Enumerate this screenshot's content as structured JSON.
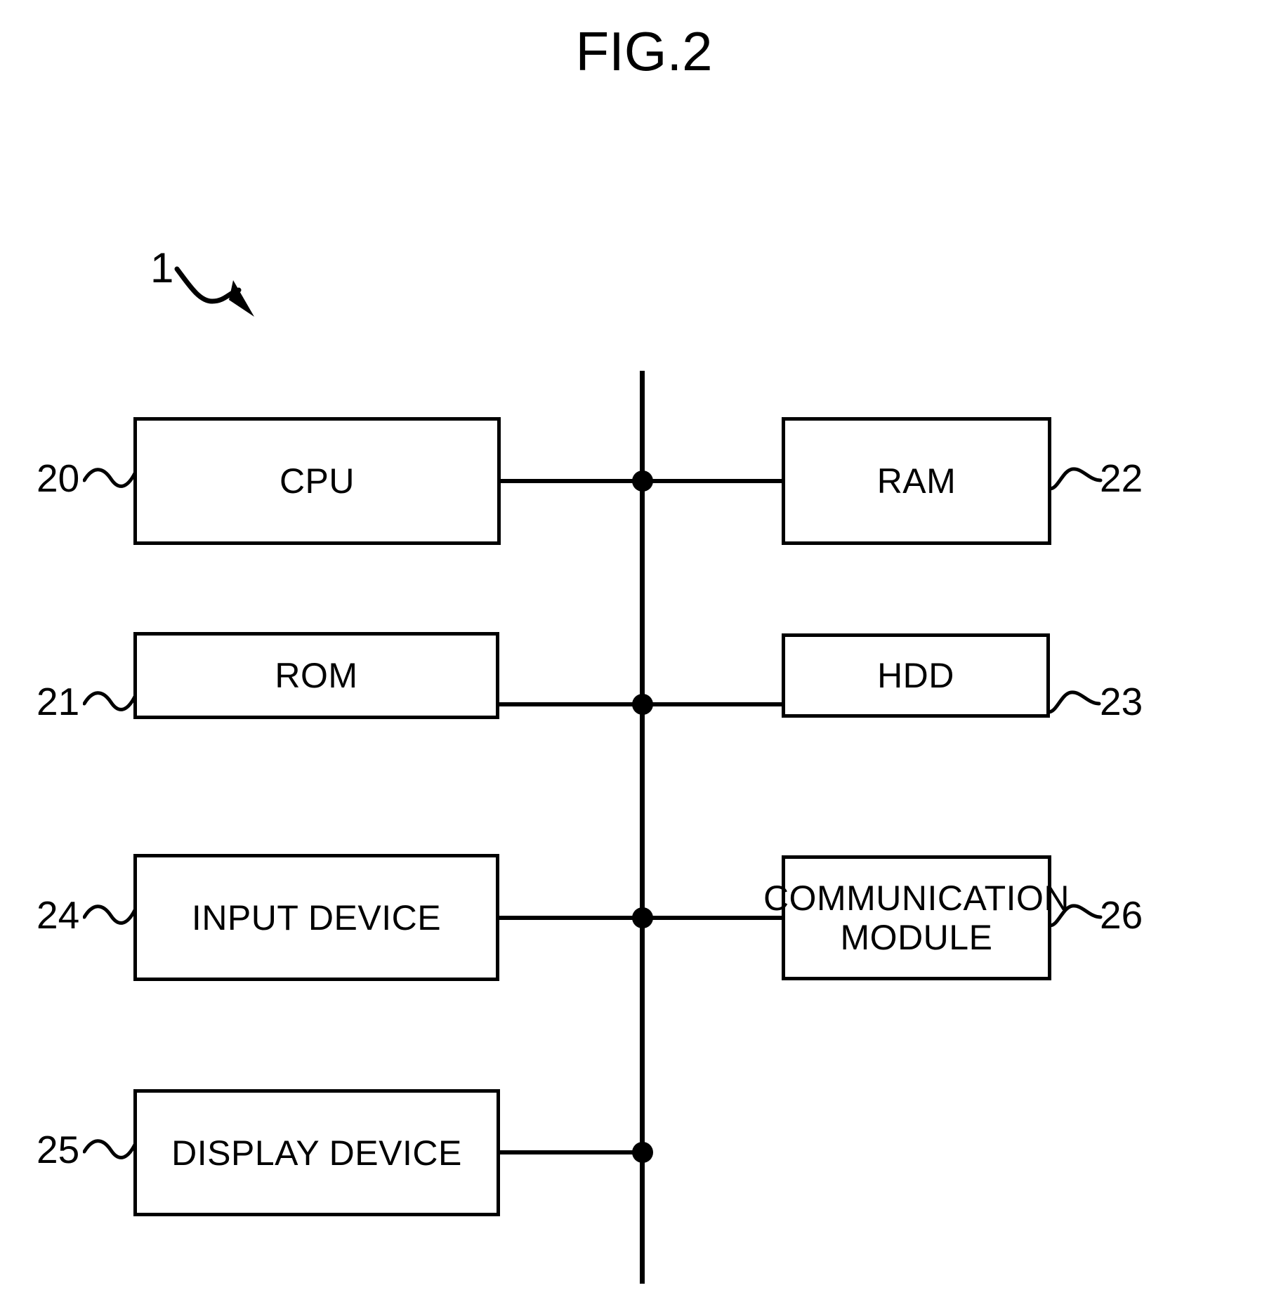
{
  "figure": {
    "title": "FIG.2",
    "system_ref": "1",
    "arrow_icon": "curved-arrow-icon"
  },
  "blocks": [
    {
      "id": "cpu",
      "label": "CPU",
      "ref": "20",
      "side": "left",
      "ref_side": "left"
    },
    {
      "id": "rom",
      "label": "ROM",
      "ref": "21",
      "side": "left",
      "ref_side": "left"
    },
    {
      "id": "input-device",
      "label": "INPUT DEVICE",
      "ref": "24",
      "side": "left",
      "ref_side": "left"
    },
    {
      "id": "display-device",
      "label": "DISPLAY DEVICE",
      "ref": "25",
      "side": "left",
      "ref_side": "left"
    },
    {
      "id": "ram",
      "label": "RAM",
      "ref": "22",
      "side": "right",
      "ref_side": "right"
    },
    {
      "id": "hdd",
      "label": "HDD",
      "ref": "23",
      "side": "right",
      "ref_side": "right"
    },
    {
      "id": "comm-module",
      "label": "COMMUNICATION\nMODULE",
      "ref": "26",
      "side": "right",
      "ref_side": "right"
    }
  ],
  "bus": {
    "name": "system-bus",
    "junction_count": 4
  },
  "colors": {
    "ink": "#000000",
    "background": "#ffffff"
  }
}
